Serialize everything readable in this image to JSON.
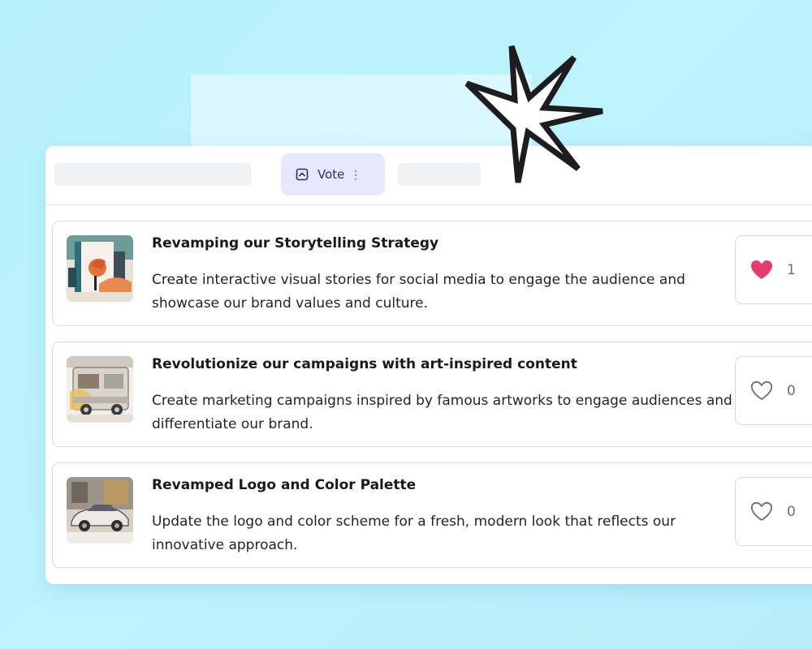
{
  "tabs": {
    "active_label": "Vote"
  },
  "ideas": [
    {
      "title": "Revamping our Storytelling Strategy",
      "description": "Create interactive visual stories for social media to engage the audience and showcase our brand values and culture.",
      "likes": "1",
      "liked": true,
      "thumb_icon": "storytelling-thumbnail"
    },
    {
      "title": "Revolutionize our campaigns with art-inspired content",
      "description": "Create marketing campaigns inspired by famous artworks to engage audiences and differentiate our brand.",
      "likes": "0",
      "liked": false,
      "thumb_icon": "campervan-thumbnail"
    },
    {
      "title": "Revamped Logo and Color Palette",
      "description": "Update the logo and color scheme for a fresh, modern look that reflects our innovative approach.",
      "likes": "0",
      "liked": false,
      "thumb_icon": "car-thumbnail"
    }
  ],
  "colors": {
    "accent": "#25307a",
    "vote_tab_bg": "#e6e9fb",
    "liked_heart": "#e23d6d",
    "background": "#bdf3fc"
  }
}
